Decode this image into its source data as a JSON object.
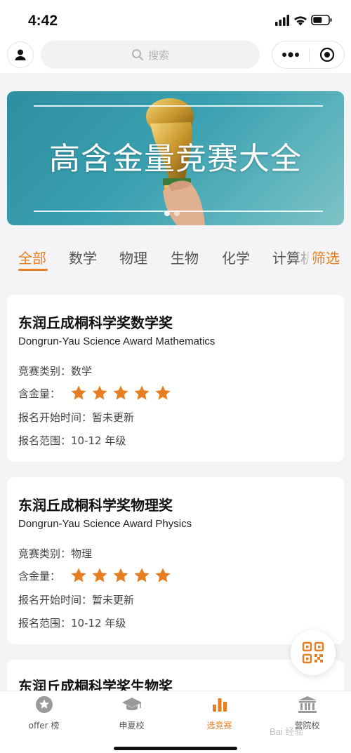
{
  "status_bar": {
    "time": "4:42"
  },
  "header": {
    "search_placeholder": "搜索"
  },
  "banner": {
    "title": "高含金量竞赛大全"
  },
  "tabs": [
    {
      "label": "全部",
      "active": true
    },
    {
      "label": "数学",
      "active": false
    },
    {
      "label": "物理",
      "active": false
    },
    {
      "label": "生物",
      "active": false
    },
    {
      "label": "化学",
      "active": false
    },
    {
      "label": "计算机",
      "active": false
    }
  ],
  "filter_label": "筛选",
  "competitions": [
    {
      "title": "东润丘成桐科学奖数学奖",
      "subtitle": "Dongrun-Yau Science Award Mathematics",
      "category_label": "竞赛类别：",
      "category": "数学",
      "value_label": "含金量：",
      "rating": 5,
      "start_label": "报名开始时间：",
      "start": "暂未更新",
      "range_label": "报名范围：",
      "range": "10-12 年级"
    },
    {
      "title": "东润丘成桐科学奖物理奖",
      "subtitle": "Dongrun-Yau Science Award Physics",
      "category_label": "竞赛类别：",
      "category": "物理",
      "value_label": "含金量：",
      "rating": 5,
      "start_label": "报名开始时间：",
      "start": "暂未更新",
      "range_label": "报名范围：",
      "range": "10-12 年级"
    },
    {
      "title": "东润丘成桐科学奖生物奖"
    }
  ],
  "bottom_nav": [
    {
      "label": "offer 榜",
      "icon": "star-badge-icon",
      "active": false
    },
    {
      "label": "申夏校",
      "icon": "graduation-cap-icon",
      "active": false
    },
    {
      "label": "选竞赛",
      "icon": "bar-chart-icon",
      "active": true
    },
    {
      "label": "营院校",
      "icon": "institution-icon",
      "active": false
    }
  ],
  "watermark": "Bai 经验",
  "colors": {
    "accent": "#e67e22",
    "banner": "#3aa0b0"
  }
}
